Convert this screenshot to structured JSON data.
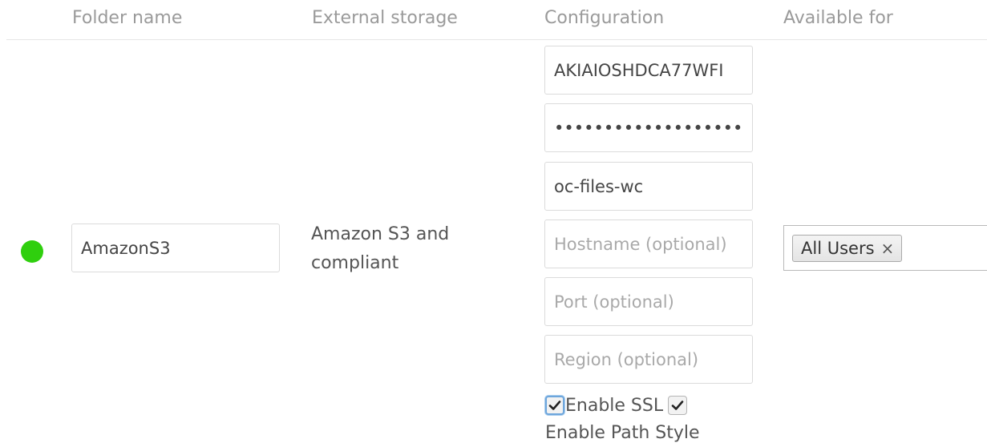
{
  "table": {
    "headers": {
      "folder_name": "Folder name",
      "external_storage": "External storage",
      "configuration": "Configuration",
      "available_for": "Available for"
    }
  },
  "mount": {
    "status_color": "#2fcf0e",
    "folder_name": "AmazonS3",
    "storage_line1": "Amazon S3 and",
    "storage_line2": "compliant",
    "config": {
      "key": "AKIAIOSHDCA77WFI",
      "secret": "jK8pQ2xR7tLm4nVb9cZ3wYs6",
      "bucket": "oc-files-wc",
      "hostname": "",
      "hostname_placeholder": "Hostname (optional)",
      "port": "",
      "port_placeholder": "Port (optional)",
      "region": "",
      "region_placeholder": "Region (optional)",
      "enable_ssl_label": "Enable SSL",
      "enable_ssl_checked": true,
      "enable_path_style_label": "Enable Path Style",
      "enable_path_style_checked": true
    },
    "available_for": {
      "tags": [
        "All Users"
      ],
      "remove_glyph": "×"
    }
  }
}
